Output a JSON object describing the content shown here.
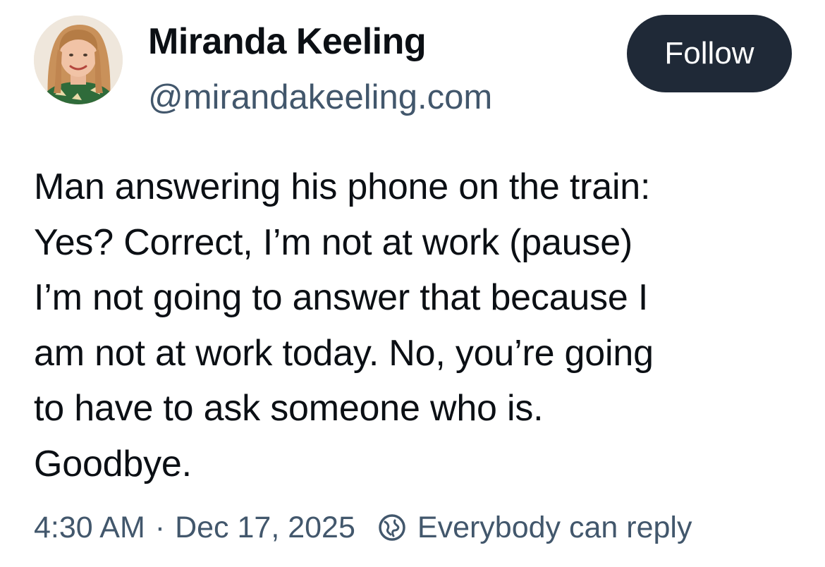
{
  "post": {
    "author": {
      "display_name": "Miranda Keeling",
      "handle": "@mirandakeeling.com"
    },
    "follow_label": "Follow",
    "text_lines": [
      "Man answering his phone on the train:",
      "Yes? Correct, I’m not at work (pause)",
      "I’m not going to answer that because I",
      "am not at work today. No, you’re going",
      "to have to ask someone who is.",
      "Goodbye."
    ],
    "time": "4:30 AM",
    "separator": "·",
    "date": "Dec 17, 2025",
    "reply_setting": "Everybody can reply",
    "reply_icon": "globe-icon"
  },
  "colors": {
    "follow_bg": "#1f2937",
    "muted_text": "#42576c",
    "primary_text": "#0b0f14"
  }
}
